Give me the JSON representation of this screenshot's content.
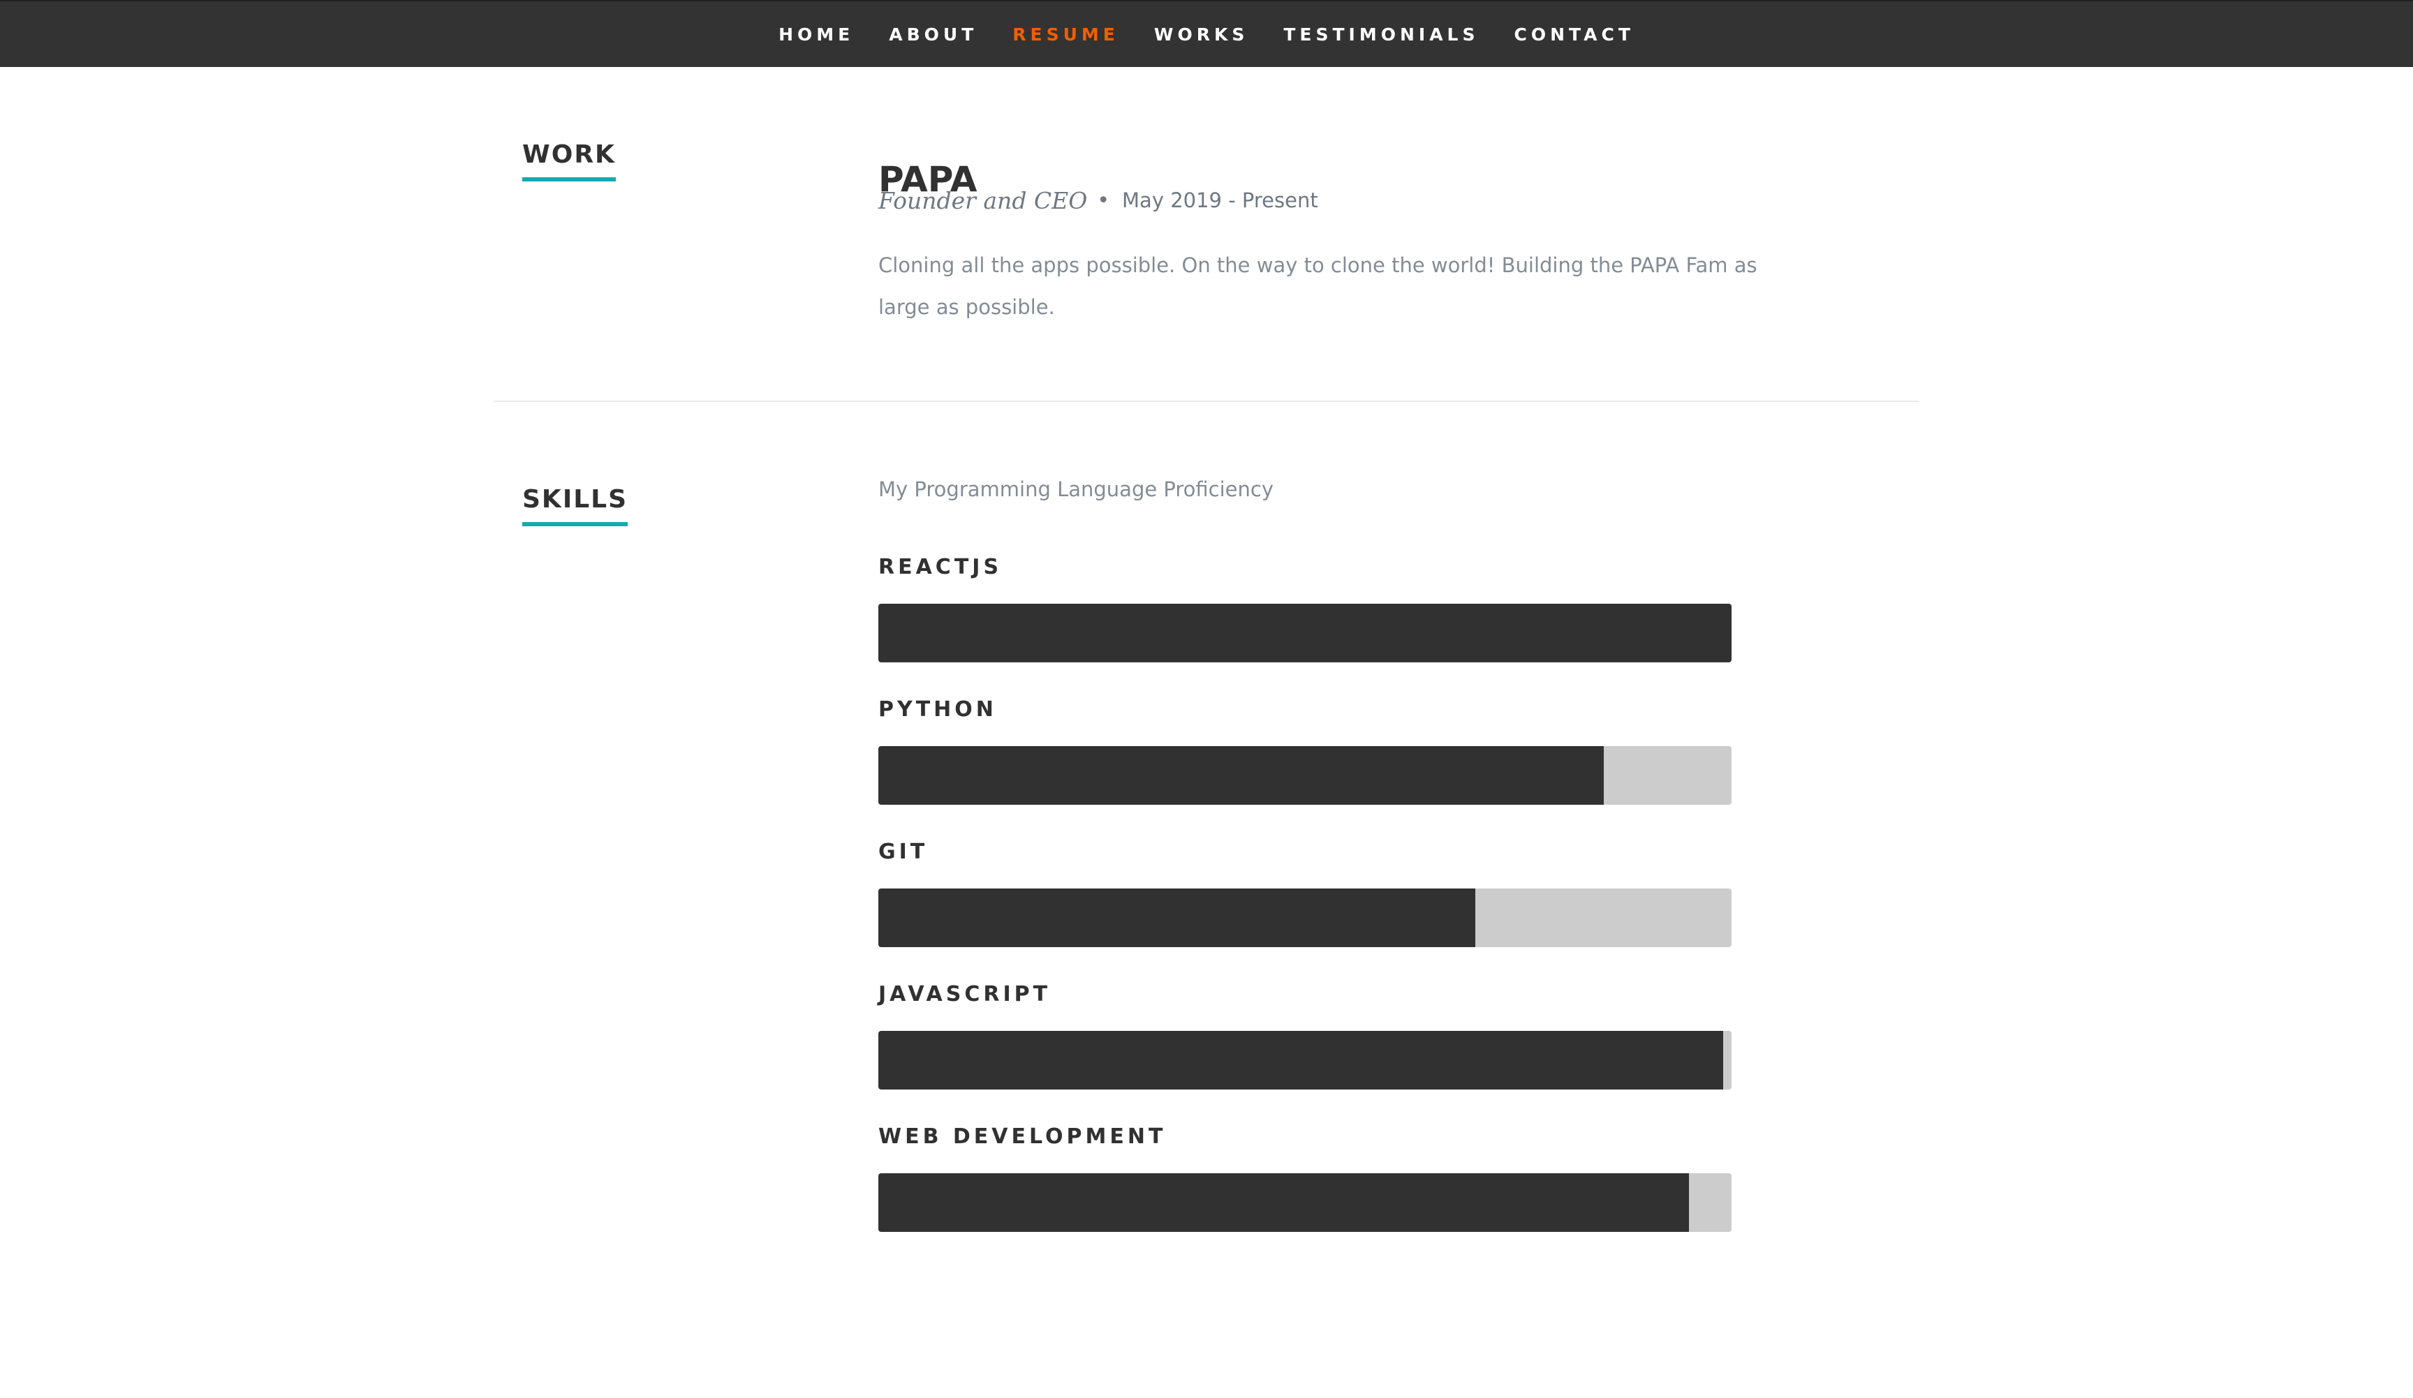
{
  "nav": {
    "items": [
      {
        "label": "HOME",
        "active": false
      },
      {
        "label": "ABOUT",
        "active": false
      },
      {
        "label": "RESUME",
        "active": true
      },
      {
        "label": "WORKS",
        "active": false
      },
      {
        "label": "TESTIMONIALS",
        "active": false
      },
      {
        "label": "CONTACT",
        "active": false
      }
    ],
    "active_color": "#f06000"
  },
  "work": {
    "heading": "WORK",
    "company": "PAPA",
    "title": "Founder and CEO",
    "bullet": "•",
    "date": "May 2019 - Present",
    "description": "Cloning all the apps possible. On the way to clone the world! Building the PAPA Fam as large as possible."
  },
  "skills": {
    "heading": "SKILLS",
    "intro": "My Programming Language Proficiency",
    "items": [
      {
        "name": "REACTJS",
        "level": 100
      },
      {
        "name": "PYTHON",
        "level": 85
      },
      {
        "name": "GIT",
        "level": 70
      },
      {
        "name": "JAVASCRIPT",
        "level": 99
      },
      {
        "name": "WEB DEVELOPMENT",
        "level": 95
      }
    ]
  },
  "colors": {
    "nav_background": "#333333",
    "accent_underline": "#11abb0",
    "bar_fill": "#313131",
    "bar_track": "#cccccc"
  }
}
